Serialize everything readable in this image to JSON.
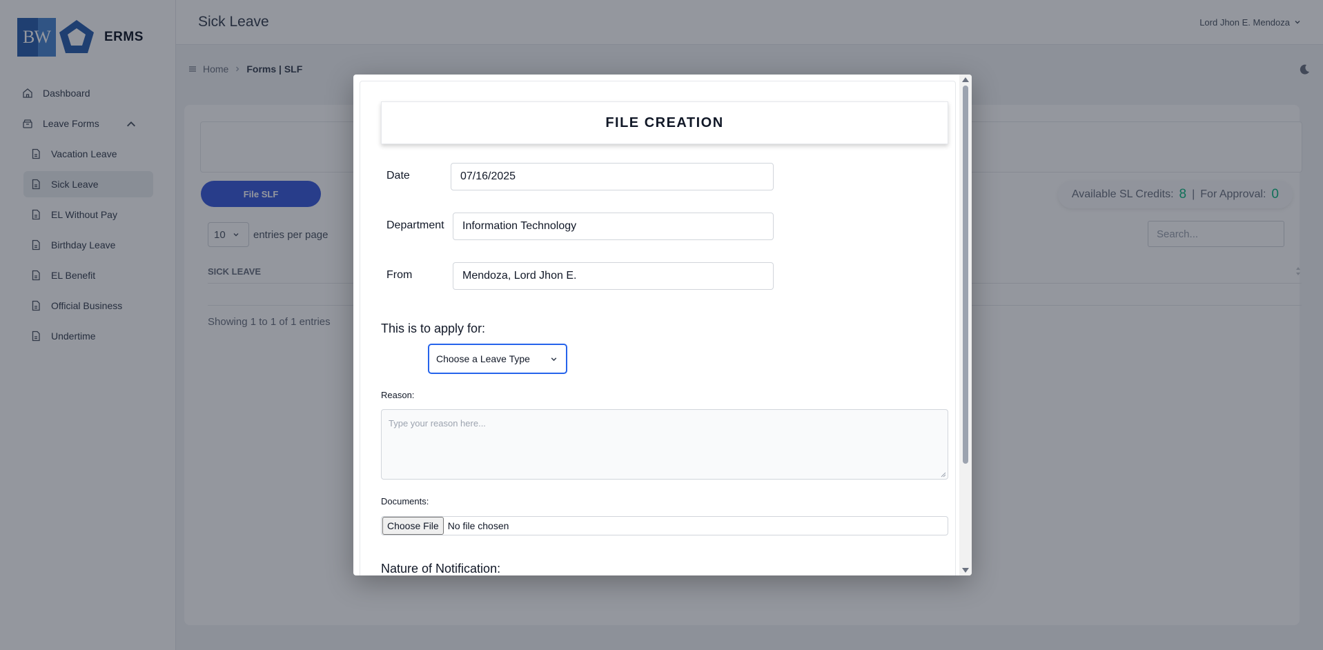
{
  "app": {
    "logo_text": "BW",
    "name": "ERMS"
  },
  "sidebar": {
    "items": [
      {
        "label": "Dashboard",
        "icon": "home-icon"
      },
      {
        "label": "Leave Forms",
        "icon": "archive-icon"
      }
    ],
    "subitems": [
      {
        "label": "Vacation Leave"
      },
      {
        "label": "Sick Leave"
      },
      {
        "label": "EL Without Pay"
      },
      {
        "label": "Birthday Leave"
      },
      {
        "label": "EL Benefit"
      },
      {
        "label": "Official Business"
      },
      {
        "label": "Undertime"
      }
    ]
  },
  "header": {
    "title": "Sick Leave",
    "user": "Lord Jhon E. Mendoza"
  },
  "breadcrumb": {
    "home": "Home",
    "current": "Forms | SLF"
  },
  "content": {
    "file_button": "File SLF",
    "credits_label": "Available SL Credits:",
    "credits_value": "8",
    "separator": "|",
    "approval_label": "For Approval:",
    "approval_value": "0",
    "entries_value": "10",
    "entries_label": "entries per page",
    "search_placeholder": "Search...",
    "column_header": "SICK LEAVE",
    "showing": "Showing 1 to 1 of 1 entries"
  },
  "modal": {
    "title": "FILE CREATION",
    "date_label": "Date",
    "date_value": "07/16/2025",
    "department_label": "Department",
    "department_value": "Information Technology",
    "from_label": "From",
    "from_value": "Mendoza, Lord Jhon E.",
    "apply_label": "This is to apply for:",
    "leave_type_value": "Choose a Leave Type",
    "reason_label": "Reason:",
    "reason_placeholder": "Type your reason here...",
    "documents_label": "Documents:",
    "choose_file": "Choose File",
    "no_file": "No file chosen",
    "nature_label": "Nature of Notification:"
  },
  "colors": {
    "accent": "#3b5bdb",
    "credits": "#10b981",
    "focus": "#2563eb"
  }
}
